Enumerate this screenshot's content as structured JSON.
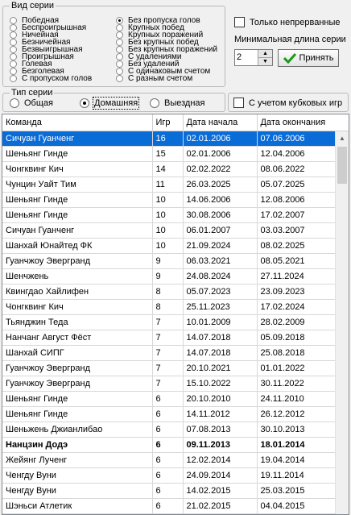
{
  "series_types": {
    "legend": "Вид серии",
    "left_options": [
      "Победная",
      "Беспроигрышная",
      "Ничейная",
      "Безничейная",
      "Безвыигрышная",
      "Проигрышная",
      "Голевая",
      "Безголевая",
      "С пропуском голов"
    ],
    "right_options": [
      "Без пропуска голов",
      "Крупных побед",
      "Крупных поражений",
      "Без крупных побед",
      "Без крупных поражений",
      "С удалениями",
      "Без удалений",
      "С одинаковым счетом",
      "С разным счетом"
    ],
    "selected_right_index": 0
  },
  "only_continuous_label": "Только непрерванные",
  "min_length": {
    "label": "Минимальная длина серии",
    "value": "2"
  },
  "accept_button": "Принять",
  "series_scope": {
    "legend": "Тип серии",
    "options": [
      "Общая",
      "Домашняя",
      "Выездная"
    ],
    "selected_index": 1
  },
  "cup_games_label": "С учетом кубковых игр",
  "table": {
    "headers": [
      "Команда",
      "Игр",
      "Дата начала",
      "Дата окончания"
    ],
    "rows": [
      [
        "Сичуан Гуанченг",
        "16",
        "02.01.2006",
        "07.06.2006"
      ],
      [
        "Шеньянг Гинде",
        "15",
        "02.01.2006",
        "12.04.2006"
      ],
      [
        "Чонгквинг Кич",
        "14",
        "02.02.2022",
        "08.06.2022"
      ],
      [
        "Чунцин Уайт Тим",
        "11",
        "26.03.2025",
        "05.07.2025"
      ],
      [
        "Шеньянг Гинде",
        "10",
        "14.06.2006",
        "12.08.2006"
      ],
      [
        "Шеньянг Гинде",
        "10",
        "30.08.2006",
        "17.02.2007"
      ],
      [
        "Сичуан Гуанченг",
        "10",
        "06.01.2007",
        "03.03.2007"
      ],
      [
        "Шанхай Юнайтед ФК",
        "10",
        "21.09.2024",
        "08.02.2025"
      ],
      [
        "Гуанчжоу Эвергранд",
        "9",
        "06.03.2021",
        "08.05.2021"
      ],
      [
        "Шенчжень",
        "9",
        "24.08.2024",
        "27.11.2024"
      ],
      [
        "Квингдао Хайлифен",
        "8",
        "05.07.2023",
        "23.09.2023"
      ],
      [
        "Чонгквинг Кич",
        "8",
        "25.11.2023",
        "17.02.2024"
      ],
      [
        "Тьянджин Теда",
        "7",
        "10.01.2009",
        "28.02.2009"
      ],
      [
        "Нанчанг Август Фёст",
        "7",
        "14.07.2018",
        "05.09.2018"
      ],
      [
        "Шанхай СИПГ",
        "7",
        "14.07.2018",
        "25.08.2018"
      ],
      [
        "Гуанчжоу Эвергранд",
        "7",
        "20.10.2021",
        "01.01.2022"
      ],
      [
        "Гуанчжоу Эвергранд",
        "7",
        "15.10.2022",
        "30.11.2022"
      ],
      [
        "Шеньянг Гинде",
        "6",
        "20.10.2010",
        "24.11.2010"
      ],
      [
        "Шеньянг Гинде",
        "6",
        "14.11.2012",
        "26.12.2012"
      ],
      [
        "Шеньжень Джианлибао",
        "6",
        "07.08.2013",
        "30.10.2013"
      ],
      [
        "Нанцзин Додэ",
        "6",
        "09.11.2013",
        "18.01.2014"
      ],
      [
        "Жейянг Лученг",
        "6",
        "12.02.2014",
        "19.04.2014"
      ],
      [
        "Ченгду Вуни",
        "6",
        "24.09.2014",
        "19.11.2014"
      ],
      [
        "Ченгду Вуни",
        "6",
        "14.02.2015",
        "25.03.2015"
      ],
      [
        "Шэньси Атлетик",
        "6",
        "21.02.2015",
        "04.04.2015"
      ]
    ],
    "selected_row": 0,
    "bold_row": 20
  }
}
